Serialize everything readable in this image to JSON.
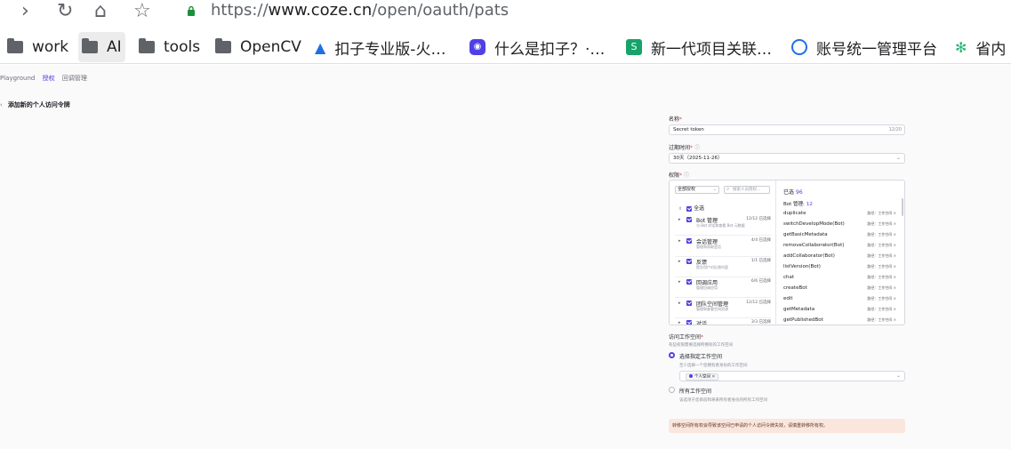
{
  "browser": {
    "url_prefix": "https://",
    "url_host": "www.coze.cn",
    "url_path": "/open/oauth/pats",
    "bookmarks": [
      {
        "label": "work"
      },
      {
        "label": "AI"
      },
      {
        "label": "tools"
      },
      {
        "label": "OpenCV"
      },
      {
        "label": "扣子专业版-火…"
      },
      {
        "label": "什么是扣子？·…"
      },
      {
        "label": "新一代项目关联…"
      },
      {
        "label": "账号统一管理平台"
      },
      {
        "label": "省内"
      }
    ]
  },
  "topnav": {
    "items": [
      "Playground",
      "授权",
      "回调管理"
    ]
  },
  "page": {
    "back_icon": "‹",
    "title": "添加新的个人访问令牌"
  },
  "form": {
    "name_label": "名称",
    "name_value": "Secret token",
    "name_count": "12/20",
    "expiry_label": "过期时间",
    "expiry_value": "30天（2025-11-26）",
    "perm_label": "权限",
    "filter_value": "全部授权",
    "search_placeholder": "搜索人员授权…",
    "select_all": "全选",
    "categories": [
      {
        "name": "Bot 管理",
        "desc": "与 Bot 对话和查看 Bot 元数据",
        "count": "12/12 已选择"
      },
      {
        "name": "会话管理",
        "desc": "管理和获取会话",
        "count": "4/4 已选择"
      },
      {
        "name": "反馈",
        "desc": "提交用户对反馈内容",
        "count": "1/1 已选择"
      },
      {
        "name": "回调应用",
        "desc": "管理回调应用",
        "count": "6/6 已选择"
      },
      {
        "name": "团队空间管理",
        "desc": "管理和查看空间资源",
        "count": "12/12 已选择"
      },
      {
        "name": "对话",
        "desc": "",
        "count": "3/3 已选择"
      }
    ],
    "selected_label": "已选",
    "selected_count": "96",
    "group_label": "Bot 管理:",
    "group_count": "12",
    "tag_label": "路径：工作空间",
    "selected_items": [
      "duplicate",
      "switchDevelopMode(Bot)",
      "getBasicMetadata",
      "removeCollaborator(Bot)",
      "addCollaborator(Bot)",
      "listVersion(Bot)",
      "chat",
      "createBot",
      "edit",
      "getMetadata",
      "getPublishedBot"
    ],
    "ws_label": "访问工作空间",
    "ws_sub": "有些权限需要选择所拥有的工作空间",
    "opt1_label": "选择指定工作空间",
    "opt1_sub": "至少选择一个您拥有者身份的工作空间",
    "chip_label": "个人空间",
    "opt2_label": "所有工作空间",
    "opt2_sub": "该选项于您目前和将来所有者身份的所有工作空间",
    "warning": "转移空间所有权会导致该空间已申请的个人访问令牌失效，请慎重转移所有权。"
  }
}
